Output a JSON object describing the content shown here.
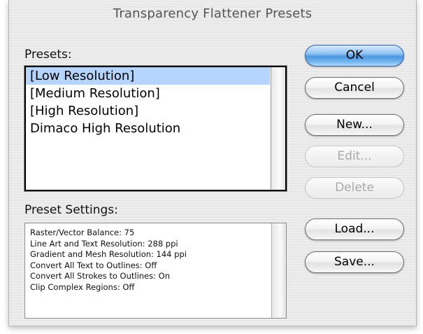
{
  "dialog": {
    "title": "Transparency Flattener Presets"
  },
  "presets": {
    "label": "Presets:",
    "items": [
      "[Low Resolution]",
      "[Medium Resolution]",
      "[High Resolution]",
      "Dimaco High Resolution"
    ],
    "selected": "[Low Resolution]"
  },
  "preset_settings": {
    "label": "Preset Settings:",
    "lines": [
      "Raster/Vector Balance: 75",
      "Line Art and Text Resolution: 288 ppi",
      "Gradient and Mesh Resolution: 144 ppi",
      "Convert All Text to Outlines: Off",
      "Convert All Strokes to Outlines: On",
      "Clip Complex Regions: Off"
    ]
  },
  "buttons": {
    "ok": "OK",
    "cancel": "Cancel",
    "new": "New...",
    "edit": "Edit...",
    "delete": "Delete",
    "load": "Load...",
    "save": "Save..."
  },
  "colors": {
    "selection": "#b5d5ff",
    "default_button": "#4b95df"
  }
}
